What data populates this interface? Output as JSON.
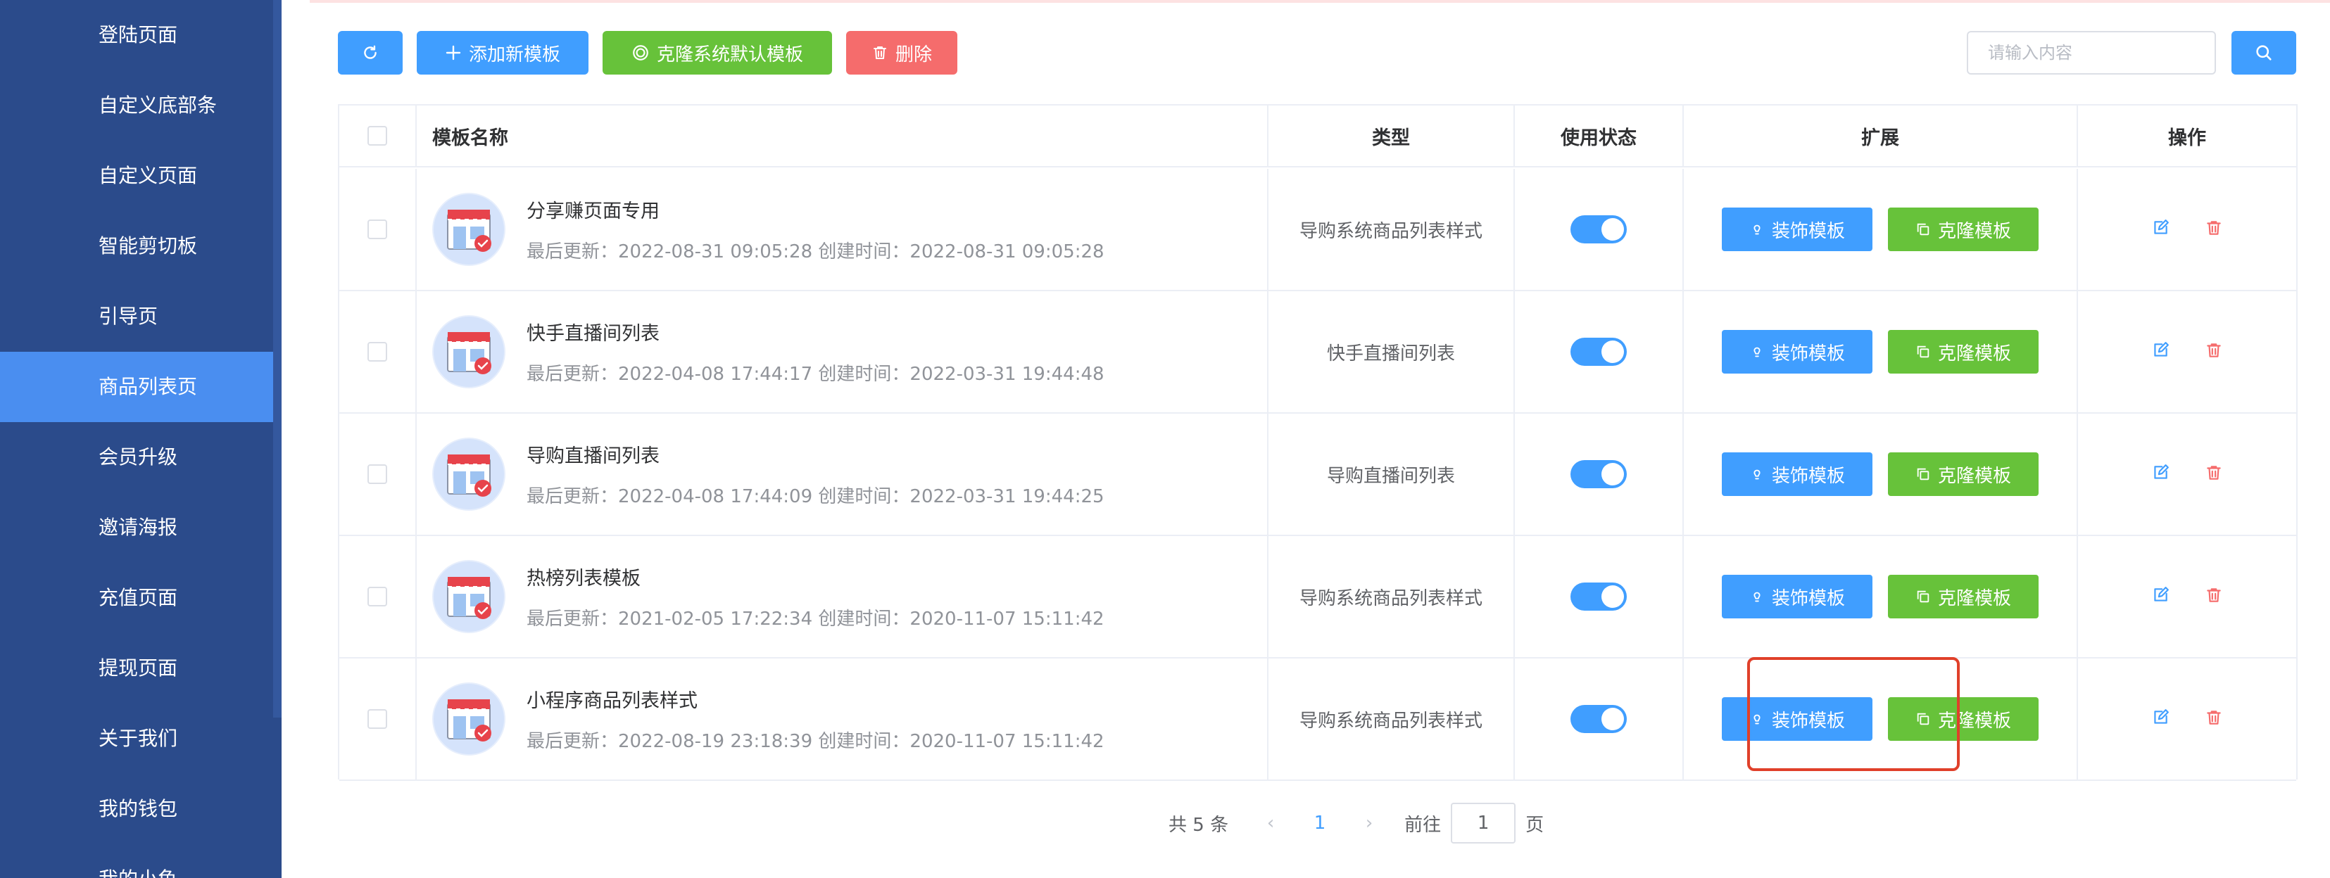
{
  "sidebar": {
    "items": [
      {
        "label": "登陆页面"
      },
      {
        "label": "自定义底部条"
      },
      {
        "label": "自定义页面"
      },
      {
        "label": "智能剪切板"
      },
      {
        "label": "引导页"
      },
      {
        "label": "商品列表页",
        "active": true
      },
      {
        "label": "会员升级"
      },
      {
        "label": "邀请海报"
      },
      {
        "label": "充值页面"
      },
      {
        "label": "提现页面"
      },
      {
        "label": "关于我们"
      },
      {
        "label": "我的钱包"
      },
      {
        "label": "我的小鱼"
      }
    ]
  },
  "toolbar": {
    "refresh_icon": "refresh-icon",
    "add_label": "添加新模板",
    "clone_default_label": "克隆系统默认模板",
    "delete_label": "删除",
    "search_placeholder": "请输入内容",
    "search_icon": "search-icon"
  },
  "table": {
    "headers": {
      "name": "模板名称",
      "type": "类型",
      "status": "使用状态",
      "ext": "扩展",
      "op": "操作"
    },
    "decorate_label": "装饰模板",
    "clone_label": "克隆模板",
    "rows": [
      {
        "name": "分享赚页面专用",
        "meta": "最后更新：2022-08-31 09:05:28 创建时间：2022-08-31 09:05:28",
        "type": "导购系统商品列表样式",
        "enabled": true
      },
      {
        "name": "快手直播间列表",
        "meta": "最后更新：2022-04-08 17:44:17 创建时间：2022-03-31 19:44:48",
        "type": "快手直播间列表",
        "enabled": true
      },
      {
        "name": "导购直播间列表",
        "meta": "最后更新：2022-04-08 17:44:09 创建时间：2022-03-31 19:44:25",
        "type": "导购直播间列表",
        "enabled": true
      },
      {
        "name": "热榜列表模板",
        "meta": "最后更新：2021-02-05 17:22:34 创建时间：2020-11-07 15:11:42",
        "type": "导购系统商品列表样式",
        "enabled": true
      },
      {
        "name": "小程序商品列表样式",
        "meta": "最后更新：2022-08-19 23:18:39 创建时间：2020-11-07 15:11:42",
        "type": "导购系统商品列表样式",
        "enabled": true
      }
    ]
  },
  "pagination": {
    "total": "共 5 条",
    "prev": "‹",
    "current": "1",
    "next": "›",
    "goto_prefix": "前往",
    "goto_value": "1",
    "goto_suffix": "页"
  },
  "colors": {
    "primary": "#409eff",
    "success": "#67c23a",
    "danger": "#f56c6c",
    "sidebar": "#2b4b8b",
    "sidebar_active": "#4a8ef0",
    "highlight": "#e0402a"
  }
}
